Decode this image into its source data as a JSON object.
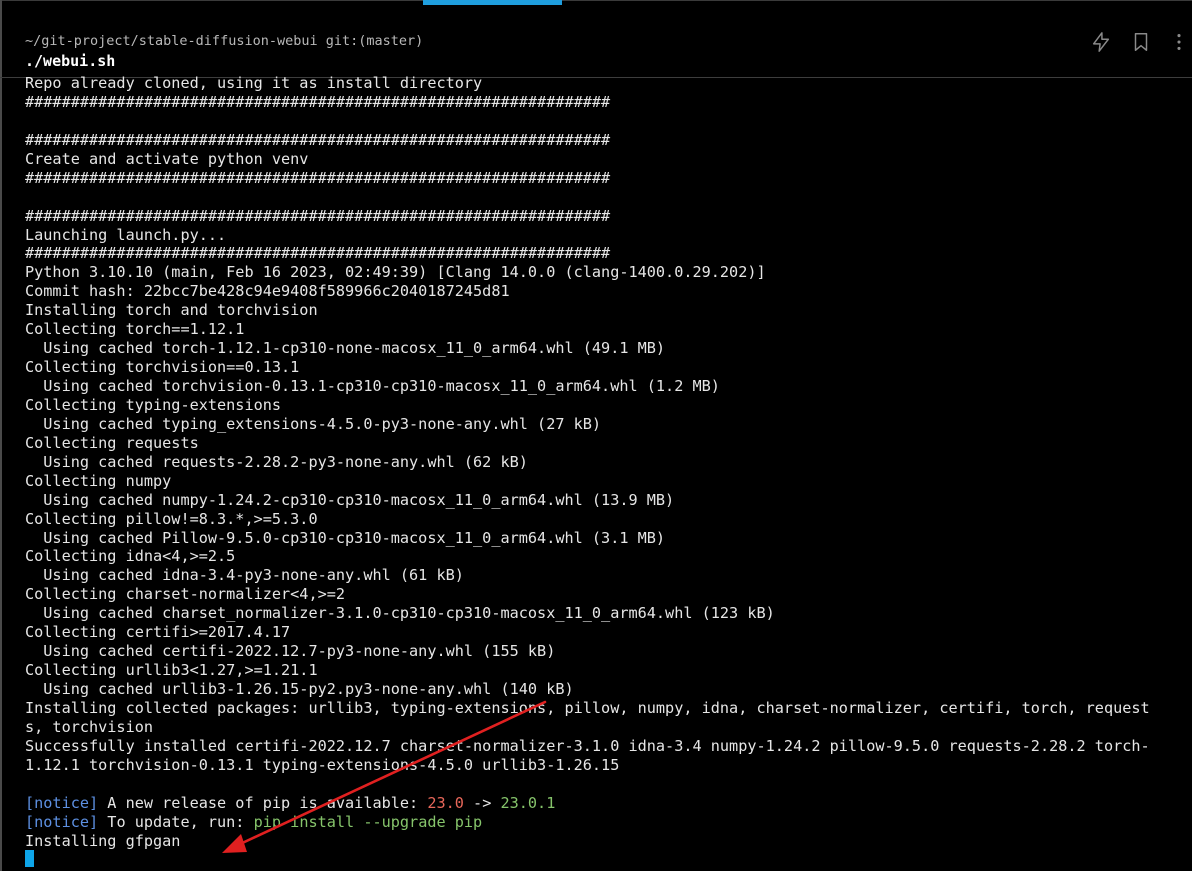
{
  "header": {
    "prompt_path": "~/git-project/stable-diffusion-webui git:(master)",
    "command": "./webui.sh",
    "icons": [
      "lightning-icon",
      "bookmark-icon",
      "more-vertical-icon"
    ]
  },
  "output": {
    "lines": [
      "Repo already cloned, using it as install directory",
      "################################################################",
      "",
      "################################################################",
      "Create and activate python venv",
      "################################################################",
      "",
      "################################################################",
      "Launching launch.py...",
      "################################################################",
      "Python 3.10.10 (main, Feb 16 2023, 02:49:39) [Clang 14.0.0 (clang-1400.0.29.202)]",
      "Commit hash: 22bcc7be428c94e9408f589966c2040187245d81",
      "Installing torch and torchvision",
      "Collecting torch==1.12.1",
      "  Using cached torch-1.12.1-cp310-none-macosx_11_0_arm64.whl (49.1 MB)",
      "Collecting torchvision==0.13.1",
      "  Using cached torchvision-0.13.1-cp310-cp310-macosx_11_0_arm64.whl (1.2 MB)",
      "Collecting typing-extensions",
      "  Using cached typing_extensions-4.5.0-py3-none-any.whl (27 kB)",
      "Collecting requests",
      "  Using cached requests-2.28.2-py3-none-any.whl (62 kB)",
      "Collecting numpy",
      "  Using cached numpy-1.24.2-cp310-cp310-macosx_11_0_arm64.whl (13.9 MB)",
      "Collecting pillow!=8.3.*,>=5.3.0",
      "  Using cached Pillow-9.5.0-cp310-cp310-macosx_11_0_arm64.whl (3.1 MB)",
      "Collecting idna<4,>=2.5",
      "  Using cached idna-3.4-py3-none-any.whl (61 kB)",
      "Collecting charset-normalizer<4,>=2",
      "  Using cached charset_normalizer-3.1.0-cp310-cp310-macosx_11_0_arm64.whl (123 kB)",
      "Collecting certifi>=2017.4.17",
      "  Using cached certifi-2022.12.7-py3-none-any.whl (155 kB)",
      "Collecting urllib3<1.27,>=1.21.1",
      "  Using cached urllib3-1.26.15-py2.py3-none-any.whl (140 kB)",
      "Installing collected packages: urllib3, typing-extensions, pillow, numpy, idna, charset-normalizer, certifi, torch, request",
      "s, torchvision",
      "Successfully installed certifi-2022.12.7 charset-normalizer-3.1.0 idna-3.4 numpy-1.24.2 pillow-9.5.0 requests-2.28.2 torch-",
      "1.12.1 torchvision-0.13.1 typing-extensions-4.5.0 urllib3-1.26.15",
      ""
    ],
    "notice1": {
      "tag": "[notice]",
      "text": " A new release of pip is available: ",
      "old_version": "23.0",
      "arrow": " -> ",
      "new_version": "23.0.1"
    },
    "notice2": {
      "tag": "[notice]",
      "text": " To update, run: ",
      "command": "pip install --upgrade pip"
    },
    "last_line": "Installing gfpgan"
  },
  "colors": {
    "background": "#000000",
    "tab_accent": "#1f9ede",
    "notice_blue": "#5d90e2",
    "version_red": "#e8675a",
    "command_green": "#86c46b",
    "cursor": "#0ea5e9",
    "annotation_arrow": "#e02020"
  }
}
